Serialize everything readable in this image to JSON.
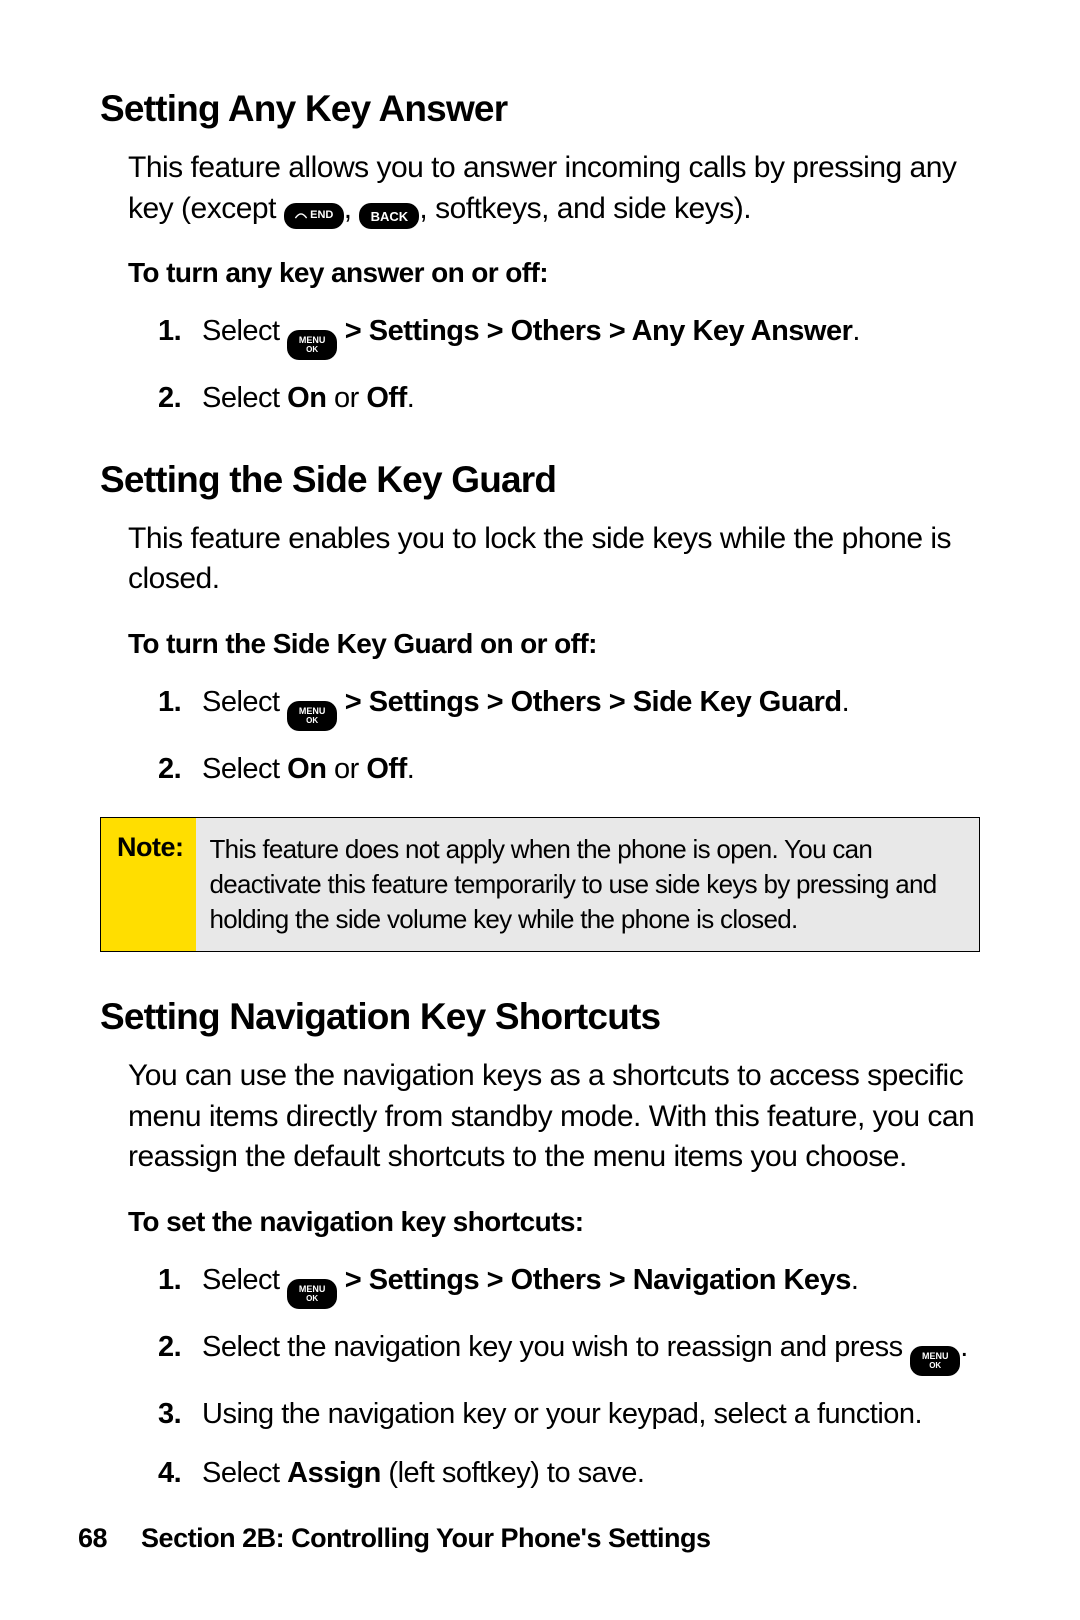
{
  "section1": {
    "heading": "Setting Any Key Answer",
    "intro_a": "This feature allows you to answer incoming calls by pressing any key (except ",
    "intro_b": ", ",
    "intro_c": ", softkeys, and side keys).",
    "sub": "To turn any key answer on or off:",
    "steps": {
      "s1_a": "Select ",
      "s1_b": " > Settings > Others > Any Key Answer",
      "s1_c": ".",
      "s2_a": "Select ",
      "s2_b": "On",
      "s2_c": " or ",
      "s2_d": "Off",
      "s2_e": "."
    }
  },
  "section2": {
    "heading": "Setting the Side Key Guard",
    "intro": "This feature enables you to lock the side keys while the phone is closed.",
    "sub": "To turn the Side Key Guard on or off:",
    "steps": {
      "s1_a": "Select ",
      "s1_b": " > Settings > Others > Side Key Guard",
      "s1_c": ".",
      "s2_a": "Select ",
      "s2_b": "On",
      "s2_c": " or ",
      "s2_d": "Off",
      "s2_e": "."
    },
    "note_label": "Note:",
    "note_text": "This feature does not apply when the phone is open. You can deactivate this feature temporarily to use side keys by pressing and holding the side volume key while the phone is closed."
  },
  "section3": {
    "heading": "Setting Navigation Key Shortcuts",
    "intro": "You can use the navigation keys as a shortcuts to access specific menu items directly from standby mode. With this feature, you can reassign the default shortcuts to the menu items you choose.",
    "sub": "To set the navigation key shortcuts:",
    "steps": {
      "s1_a": "Select ",
      "s1_b": " > Settings > Others > Navigation Keys",
      "s1_c": ".",
      "s2_a": "Select the navigation key you wish to reassign and press ",
      "s2_b": ".",
      "s3": "Using the navigation key or your keypad, select a function.",
      "s4_a": "Select ",
      "s4_b": "Assign",
      "s4_c": " (left softkey) to save."
    }
  },
  "footer": {
    "page": "68",
    "text": "Section 2B: Controlling Your Phone's Settings"
  },
  "icons": {
    "end_key": "END",
    "back_key": "BACK",
    "menu_top": "MENU",
    "menu_bot": "OK"
  }
}
